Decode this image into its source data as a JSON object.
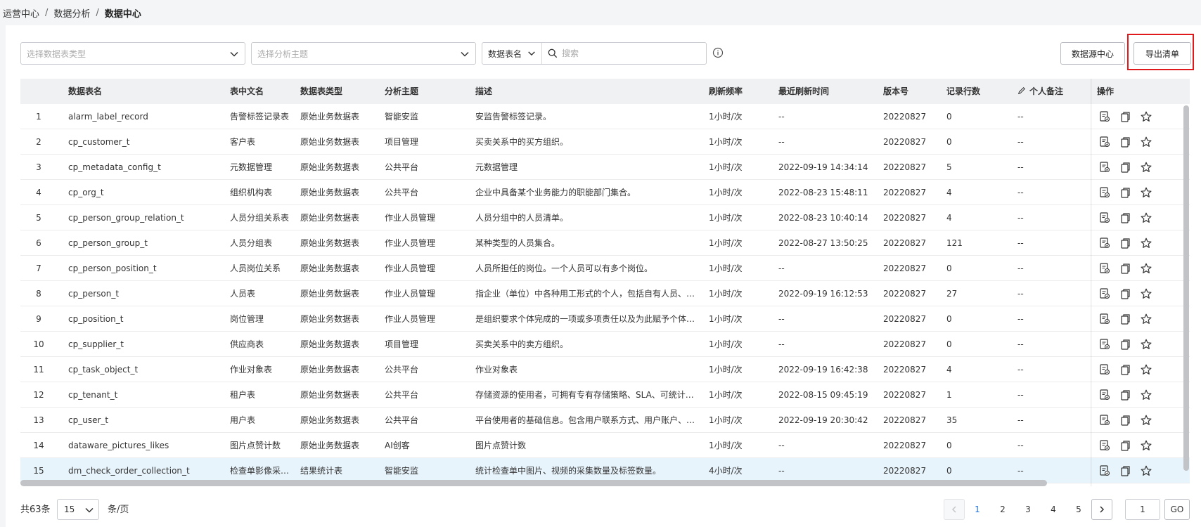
{
  "breadcrumb": {
    "items": [
      "运营中心",
      "数据分析"
    ],
    "current": "数据中心",
    "separator": "/"
  },
  "filters": {
    "table_type_placeholder": "选择数据表类型",
    "topic_placeholder": "选择分析主题",
    "search_field": "数据表名",
    "search_placeholder": "搜索"
  },
  "buttons": {
    "datasource": "数据源中心",
    "export": "导出清单"
  },
  "table": {
    "columns": {
      "name": "数据表名",
      "cn_name": "表中文名",
      "type": "数据表类型",
      "topic": "分析主题",
      "desc": "描述",
      "freq": "刷新频率",
      "last_refresh": "最近刷新时间",
      "version": "版本号",
      "rows": "记录行数",
      "remark": "个人备注",
      "ops": "操作"
    },
    "rows": [
      {
        "idx": "1",
        "name": "alarm_label_record",
        "cn": "告警标签记录表",
        "type": "原始业务数据表",
        "topic": "智能安监",
        "desc": "安监告警标签记录。",
        "freq": "1小时/次",
        "last": "--",
        "ver": "20220827",
        "count": "0",
        "remark": "--"
      },
      {
        "idx": "2",
        "name": "cp_customer_t",
        "cn": "客户表",
        "type": "原始业务数据表",
        "topic": "项目管理",
        "desc": "买卖关系中的买方组织。",
        "freq": "1小时/次",
        "last": "--",
        "ver": "20220827",
        "count": "0",
        "remark": "--"
      },
      {
        "idx": "3",
        "name": "cp_metadata_config_t",
        "cn": "元数据管理",
        "type": "原始业务数据表",
        "topic": "公共平台",
        "desc": "元数据管理",
        "freq": "1小时/次",
        "last": "2022-09-19 14:34:14",
        "ver": "20220827",
        "count": "5",
        "remark": "--"
      },
      {
        "idx": "4",
        "name": "cp_org_t",
        "cn": "组织机构表",
        "type": "原始业务数据表",
        "topic": "公共平台",
        "desc": "企业中具备某个业务能力的职能部门集合。",
        "freq": "1小时/次",
        "last": "2022-08-23 15:48:11",
        "ver": "20220827",
        "count": "4",
        "remark": "--"
      },
      {
        "idx": "5",
        "name": "cp_person_group_relation_t",
        "cn": "人员分组关系表",
        "type": "原始业务数据表",
        "topic": "作业人员管理",
        "desc": "人员分组中的人员清单。",
        "freq": "1小时/次",
        "last": "2022-08-23 10:40:14",
        "ver": "20220827",
        "count": "4",
        "remark": "--"
      },
      {
        "idx": "6",
        "name": "cp_person_group_t",
        "cn": "人员分组表",
        "type": "原始业务数据表",
        "topic": "作业人员管理",
        "desc": "某种类型的人员集合。",
        "freq": "1小时/次",
        "last": "2022-08-27 13:50:25",
        "ver": "20220827",
        "count": "121",
        "remark": "--"
      },
      {
        "idx": "7",
        "name": "cp_person_position_t",
        "cn": "人员岗位关系",
        "type": "原始业务数据表",
        "topic": "作业人员管理",
        "desc": "人员所担任的岗位。一个人员可以有多个岗位。",
        "freq": "1小时/次",
        "last": "--",
        "ver": "20220827",
        "count": "0",
        "remark": "--"
      },
      {
        "idx": "8",
        "name": "cp_person_t",
        "cn": "人员表",
        "type": "原始业务数据表",
        "topic": "作业人员管理",
        "desc": "指企业（单位）中各种用工形式的个人，包括自有人员、外包人员等。",
        "freq": "1小时/次",
        "last": "2022-09-19 16:12:53",
        "ver": "20220827",
        "count": "27",
        "remark": "--"
      },
      {
        "idx": "9",
        "name": "cp_position_t",
        "cn": "岗位管理",
        "type": "原始业务数据表",
        "topic": "作业人员管理",
        "desc": "是组织要求个体完成的一项或多项责任以及为此赋予个体的权力的总和。",
        "freq": "1小时/次",
        "last": "--",
        "ver": "20220827",
        "count": "0",
        "remark": "--"
      },
      {
        "idx": "10",
        "name": "cp_supplier_t",
        "cn": "供应商表",
        "type": "原始业务数据表",
        "topic": "项目管理",
        "desc": "买卖关系中的卖方组织。",
        "freq": "1小时/次",
        "last": "--",
        "ver": "20220827",
        "count": "0",
        "remark": "--"
      },
      {
        "idx": "11",
        "name": "cp_task_object_t",
        "cn": "作业对象表",
        "type": "原始业务数据表",
        "topic": "公共平台",
        "desc": "作业对象表",
        "freq": "1小时/次",
        "last": "2022-09-19 16:42:38",
        "ver": "20220827",
        "count": "4",
        "remark": "--"
      },
      {
        "idx": "12",
        "name": "cp_tenant_t",
        "cn": "租户表",
        "type": "原始业务数据表",
        "topic": "公共平台",
        "desc": "存储资源的使用者，可拥有专有存储策略、SLA、可统计的资源使用量。",
        "freq": "1小时/次",
        "last": "2022-08-15 09:45:19",
        "ver": "20220827",
        "count": "1",
        "remark": "--"
      },
      {
        "idx": "13",
        "name": "cp_user_t",
        "cn": "用户表",
        "type": "原始业务数据表",
        "topic": "公共平台",
        "desc": "平台使用者的基础信息。包含用户联系方式、用户账户、用户角色等。",
        "freq": "1小时/次",
        "last": "2022-09-19 20:30:42",
        "ver": "20220827",
        "count": "35",
        "remark": "--"
      },
      {
        "idx": "14",
        "name": "dataware_pictures_likes",
        "cn": "图片点赞计数",
        "type": "原始业务数据表",
        "topic": "AI创客",
        "desc": "图片点赞计数",
        "freq": "1小时/次",
        "last": "--",
        "ver": "20220827",
        "count": "0",
        "remark": "--"
      },
      {
        "idx": "15",
        "name": "dm_check_order_collection_t",
        "cn": "检查单影像采集统计表",
        "type": "结果统计表",
        "topic": "智能安监",
        "desc": "统计检查单中图片、视频的采集数量及标签数量。",
        "freq": "4小时/次",
        "last": "--",
        "ver": "20220827",
        "count": "0",
        "remark": "--"
      }
    ],
    "selected_row_index": 14,
    "op_icons": [
      "detail-icon",
      "copy-icon",
      "star-icon"
    ]
  },
  "pagination": {
    "total": "共63条",
    "page_size": "15",
    "per_page": "条/页",
    "pages": [
      "1",
      "2",
      "3",
      "4",
      "5"
    ],
    "current": "1",
    "jump_value": "1",
    "go": "GO"
  },
  "colors": {
    "accent": "#1a73e8",
    "highlight": "#e0191c",
    "selected_row": "#e8f4fc",
    "header_bg": "#f0f1f3"
  }
}
